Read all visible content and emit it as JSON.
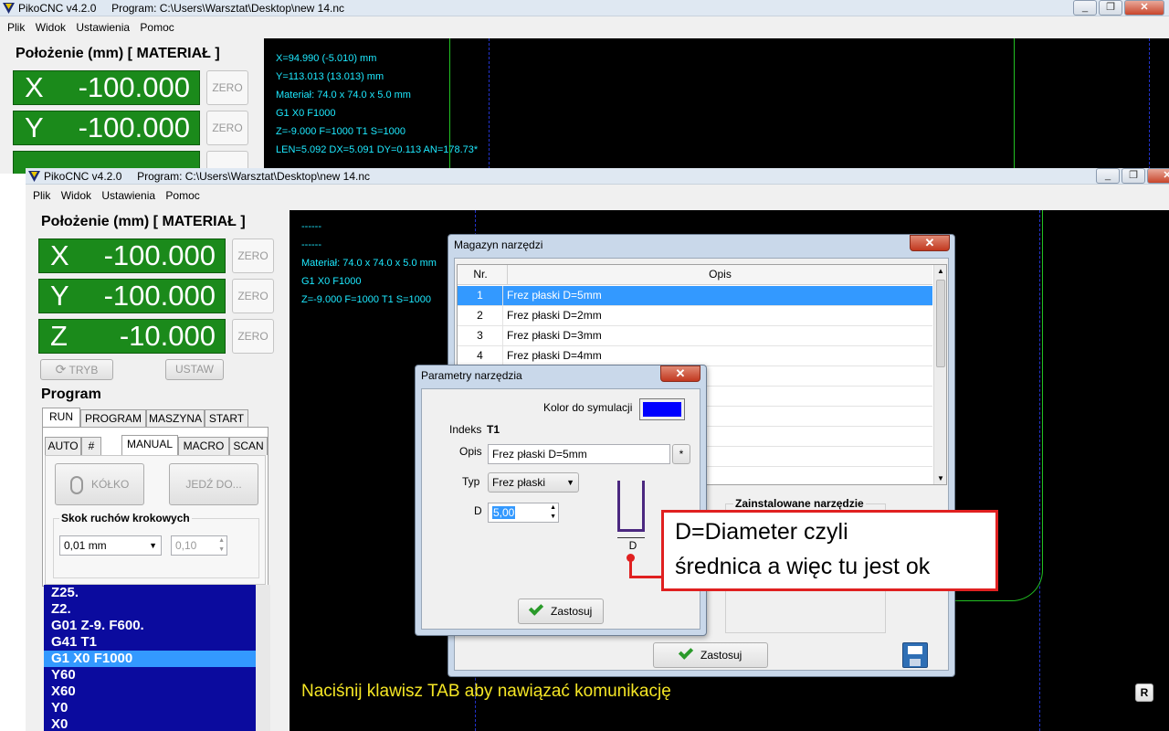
{
  "bg": {
    "title": "PikoCNC v4.2.0",
    "program_path": "Program: C:\\Users\\Warsztat\\Desktop\\new 14.nc",
    "menu": [
      "Plik",
      "Widok",
      "Ustawienia",
      "Pomoc"
    ],
    "section": "Położenie (mm) [ MATERIAŁ ]",
    "axes": [
      {
        "name": "X",
        "value": "-100.000"
      },
      {
        "name": "Y",
        "value": "-100.000"
      }
    ],
    "zero_label": "ZERO",
    "console": [
      "X=94.990 (-5.010) mm",
      "Y=113.013 (13.013) mm",
      "Materiał: 74.0 x 74.0 x 5.0 mm",
      "G1 X0 F1000",
      "Z=-9.000 F=1000 T1 S=1000",
      "LEN=5.092 DX=5.091 DY=0.113 AN=178.73*"
    ],
    "window_buttons": [
      "_",
      "❐",
      "✕"
    ]
  },
  "fg": {
    "title": "PikoCNC v4.2.0",
    "program_path": "Program: C:\\Users\\Warsztat\\Desktop\\new 14.nc",
    "menu": [
      "Plik",
      "Widok",
      "Ustawienia",
      "Pomoc"
    ],
    "section": "Położenie (mm) [ MATERIAŁ ]",
    "axes": [
      {
        "name": "X",
        "value": "-100.000"
      },
      {
        "name": "Y",
        "value": "-100.000"
      },
      {
        "name": "Z",
        "value": "-10.000"
      }
    ],
    "zero_label": "ZERO",
    "tryb_label": "TRYB",
    "ustaw_label": "USTAW",
    "program_title": "Program",
    "main_tabs": [
      "RUN",
      "PROGRAM",
      "MASZYNA",
      "START"
    ],
    "sub_tabs": [
      "AUTO",
      "#",
      "MANUAL",
      "MACRO",
      "SCAN"
    ],
    "kolko_label": "KÓŁKO",
    "jedz_label": "JEDŹ DO...",
    "step_group_label": "Skok ruchów krokowych",
    "step_select": "0,01 mm",
    "step_value": "0,10",
    "code_lines": [
      "Z25.",
      "Z2.",
      "G01 Z-9. F600.",
      "G41 T1",
      "G1 X0 F1000",
      "Y60",
      "X60",
      "Y0",
      "X0"
    ],
    "console": [
      "------",
      "------",
      "Materiał: 74.0 x 74.0 x 5.0 mm",
      "G1 X0 F1000",
      "Z=-9.000 F=1000 T1 S=1000"
    ],
    "status_message": "Naciśnij klawisz TAB aby nawiązać komunikację",
    "r_button": "R",
    "window_buttons": [
      "_",
      "❐",
      "✕"
    ]
  },
  "magazine": {
    "title": "Magazyn narzędzi",
    "close": "✕",
    "col_nr": "Nr.",
    "col_opis": "Opis",
    "rows": [
      {
        "nr": "1",
        "opis": "Frez płaski D=5mm"
      },
      {
        "nr": "2",
        "opis": "Frez płaski D=2mm"
      },
      {
        "nr": "3",
        "opis": "Frez płaski D=3mm"
      },
      {
        "nr": "4",
        "opis": "Frez płaski D=4mm"
      }
    ],
    "installed_label": "Zainstalowane narzędzie",
    "apply_label": "Zastosuj"
  },
  "params": {
    "title": "Parametry narzędzia",
    "close": "✕",
    "color_label": "Kolor do symulacji",
    "sim_color": "#0000ff",
    "index_label": "Indeks",
    "index_value": "T1",
    "opis_label": "Opis",
    "opis_value": "Frez płaski D=5mm",
    "opis_button": "*",
    "typ_label": "Typ",
    "typ_value": "Frez płaski",
    "d_label": "D",
    "d_value": "5,00",
    "diagram_label": "D",
    "apply_label": "Zastosuj"
  },
  "callout": {
    "lines": [
      "D=Diameter czyli",
      "średnica a więc tu jest ok"
    ],
    "color": "#e02020"
  }
}
